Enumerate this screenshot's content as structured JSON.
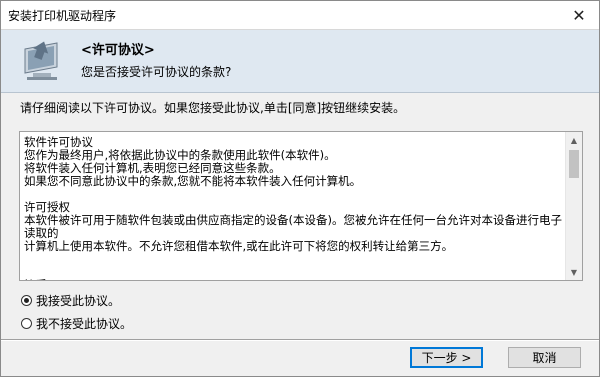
{
  "window": {
    "title": "安装打印机驱动程序",
    "close_glyph": "✕"
  },
  "header": {
    "title": "<许可协议>",
    "subtitle": "您是否接受许可协议的条款?",
    "icon": "computer-install-icon"
  },
  "instruction": "请仔细阅读以下许可协议。如果您接受此协议,单击[同意]按钮继续安装。",
  "license": {
    "text": "软件许可协议\n您作为最终用户,将依据此协议中的条款使用此软件(本软件)。\n将软件装入任何计算机,表明您已经同意这些条款。\n如果您不同意此协议中的条款,您就不能将本软件装入任何计算机。\n\n许可授权\n本软件被许可用于随软件包装或由供应商指定的设备(本设备)。您被允许在任何一台允许对本设备进行电子读取的\n计算机上使用本软件。不允许您租借本软件,或在此许可下将您的权利转让给第三方。\n\n\n接受\n您接受软件和有关文件,使您接受此协议中的条款。"
  },
  "options": {
    "accept": "我接受此协议。",
    "decline": "我不接受此协议。",
    "selected": "accept"
  },
  "buttons": {
    "next": "下一步 >",
    "cancel": "取消"
  }
}
